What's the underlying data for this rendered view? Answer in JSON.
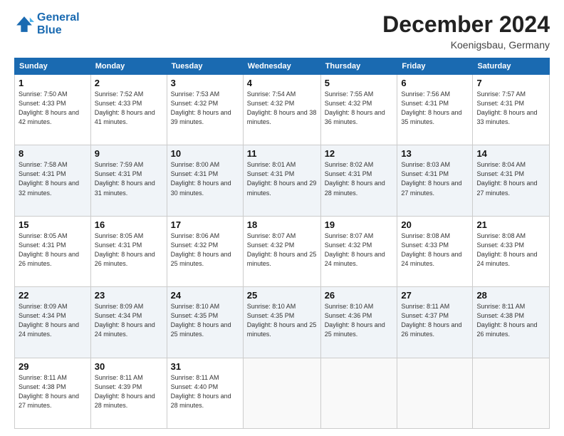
{
  "header": {
    "logo_line1": "General",
    "logo_line2": "Blue",
    "month_title": "December 2024",
    "location": "Koenigsbau, Germany"
  },
  "weekdays": [
    "Sunday",
    "Monday",
    "Tuesday",
    "Wednesday",
    "Thursday",
    "Friday",
    "Saturday"
  ],
  "weeks": [
    [
      {
        "day": "1",
        "sunrise": "Sunrise: 7:50 AM",
        "sunset": "Sunset: 4:33 PM",
        "daylight": "Daylight: 8 hours and 42 minutes."
      },
      {
        "day": "2",
        "sunrise": "Sunrise: 7:52 AM",
        "sunset": "Sunset: 4:33 PM",
        "daylight": "Daylight: 8 hours and 41 minutes."
      },
      {
        "day": "3",
        "sunrise": "Sunrise: 7:53 AM",
        "sunset": "Sunset: 4:32 PM",
        "daylight": "Daylight: 8 hours and 39 minutes."
      },
      {
        "day": "4",
        "sunrise": "Sunrise: 7:54 AM",
        "sunset": "Sunset: 4:32 PM",
        "daylight": "Daylight: 8 hours and 38 minutes."
      },
      {
        "day": "5",
        "sunrise": "Sunrise: 7:55 AM",
        "sunset": "Sunset: 4:32 PM",
        "daylight": "Daylight: 8 hours and 36 minutes."
      },
      {
        "day": "6",
        "sunrise": "Sunrise: 7:56 AM",
        "sunset": "Sunset: 4:31 PM",
        "daylight": "Daylight: 8 hours and 35 minutes."
      },
      {
        "day": "7",
        "sunrise": "Sunrise: 7:57 AM",
        "sunset": "Sunset: 4:31 PM",
        "daylight": "Daylight: 8 hours and 33 minutes."
      }
    ],
    [
      {
        "day": "8",
        "sunrise": "Sunrise: 7:58 AM",
        "sunset": "Sunset: 4:31 PM",
        "daylight": "Daylight: 8 hours and 32 minutes."
      },
      {
        "day": "9",
        "sunrise": "Sunrise: 7:59 AM",
        "sunset": "Sunset: 4:31 PM",
        "daylight": "Daylight: 8 hours and 31 minutes."
      },
      {
        "day": "10",
        "sunrise": "Sunrise: 8:00 AM",
        "sunset": "Sunset: 4:31 PM",
        "daylight": "Daylight: 8 hours and 30 minutes."
      },
      {
        "day": "11",
        "sunrise": "Sunrise: 8:01 AM",
        "sunset": "Sunset: 4:31 PM",
        "daylight": "Daylight: 8 hours and 29 minutes."
      },
      {
        "day": "12",
        "sunrise": "Sunrise: 8:02 AM",
        "sunset": "Sunset: 4:31 PM",
        "daylight": "Daylight: 8 hours and 28 minutes."
      },
      {
        "day": "13",
        "sunrise": "Sunrise: 8:03 AM",
        "sunset": "Sunset: 4:31 PM",
        "daylight": "Daylight: 8 hours and 27 minutes."
      },
      {
        "day": "14",
        "sunrise": "Sunrise: 8:04 AM",
        "sunset": "Sunset: 4:31 PM",
        "daylight": "Daylight: 8 hours and 27 minutes."
      }
    ],
    [
      {
        "day": "15",
        "sunrise": "Sunrise: 8:05 AM",
        "sunset": "Sunset: 4:31 PM",
        "daylight": "Daylight: 8 hours and 26 minutes."
      },
      {
        "day": "16",
        "sunrise": "Sunrise: 8:05 AM",
        "sunset": "Sunset: 4:31 PM",
        "daylight": "Daylight: 8 hours and 26 minutes."
      },
      {
        "day": "17",
        "sunrise": "Sunrise: 8:06 AM",
        "sunset": "Sunset: 4:32 PM",
        "daylight": "Daylight: 8 hours and 25 minutes."
      },
      {
        "day": "18",
        "sunrise": "Sunrise: 8:07 AM",
        "sunset": "Sunset: 4:32 PM",
        "daylight": "Daylight: 8 hours and 25 minutes."
      },
      {
        "day": "19",
        "sunrise": "Sunrise: 8:07 AM",
        "sunset": "Sunset: 4:32 PM",
        "daylight": "Daylight: 8 hours and 24 minutes."
      },
      {
        "day": "20",
        "sunrise": "Sunrise: 8:08 AM",
        "sunset": "Sunset: 4:33 PM",
        "daylight": "Daylight: 8 hours and 24 minutes."
      },
      {
        "day": "21",
        "sunrise": "Sunrise: 8:08 AM",
        "sunset": "Sunset: 4:33 PM",
        "daylight": "Daylight: 8 hours and 24 minutes."
      }
    ],
    [
      {
        "day": "22",
        "sunrise": "Sunrise: 8:09 AM",
        "sunset": "Sunset: 4:34 PM",
        "daylight": "Daylight: 8 hours and 24 minutes."
      },
      {
        "day": "23",
        "sunrise": "Sunrise: 8:09 AM",
        "sunset": "Sunset: 4:34 PM",
        "daylight": "Daylight: 8 hours and 24 minutes."
      },
      {
        "day": "24",
        "sunrise": "Sunrise: 8:10 AM",
        "sunset": "Sunset: 4:35 PM",
        "daylight": "Daylight: 8 hours and 25 minutes."
      },
      {
        "day": "25",
        "sunrise": "Sunrise: 8:10 AM",
        "sunset": "Sunset: 4:35 PM",
        "daylight": "Daylight: 8 hours and 25 minutes."
      },
      {
        "day": "26",
        "sunrise": "Sunrise: 8:10 AM",
        "sunset": "Sunset: 4:36 PM",
        "daylight": "Daylight: 8 hours and 25 minutes."
      },
      {
        "day": "27",
        "sunrise": "Sunrise: 8:11 AM",
        "sunset": "Sunset: 4:37 PM",
        "daylight": "Daylight: 8 hours and 26 minutes."
      },
      {
        "day": "28",
        "sunrise": "Sunrise: 8:11 AM",
        "sunset": "Sunset: 4:38 PM",
        "daylight": "Daylight: 8 hours and 26 minutes."
      }
    ],
    [
      {
        "day": "29",
        "sunrise": "Sunrise: 8:11 AM",
        "sunset": "Sunset: 4:38 PM",
        "daylight": "Daylight: 8 hours and 27 minutes."
      },
      {
        "day": "30",
        "sunrise": "Sunrise: 8:11 AM",
        "sunset": "Sunset: 4:39 PM",
        "daylight": "Daylight: 8 hours and 28 minutes."
      },
      {
        "day": "31",
        "sunrise": "Sunrise: 8:11 AM",
        "sunset": "Sunset: 4:40 PM",
        "daylight": "Daylight: 8 hours and 28 minutes."
      },
      null,
      null,
      null,
      null
    ]
  ]
}
